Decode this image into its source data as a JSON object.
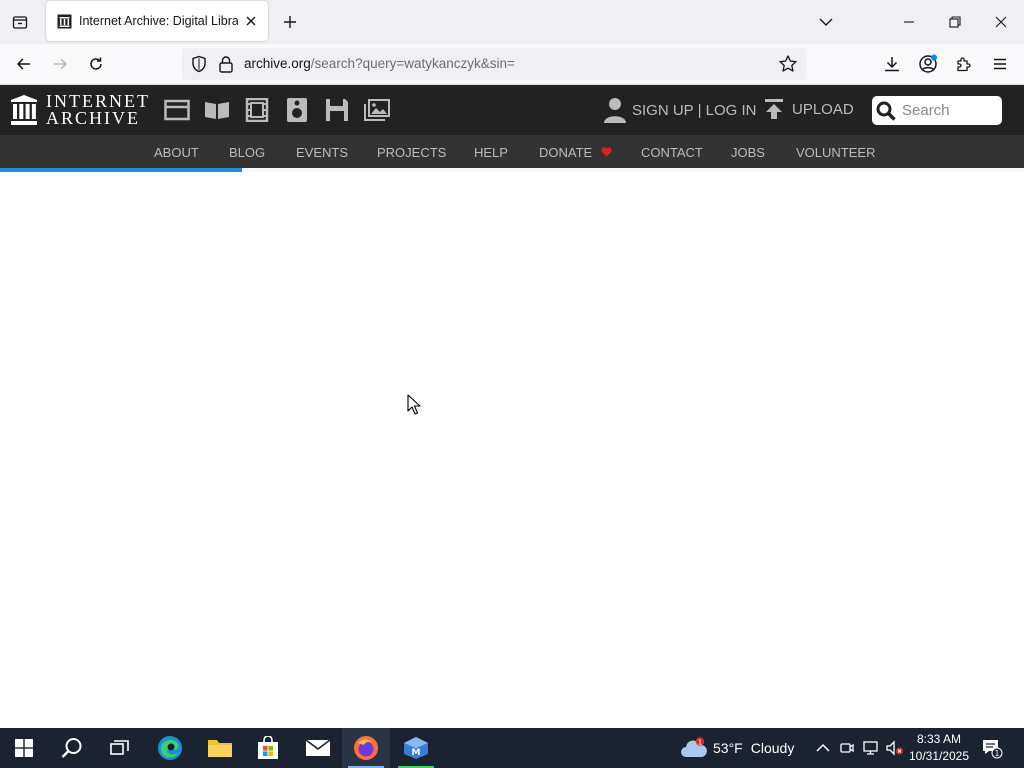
{
  "browser": {
    "tab_title": "Internet Archive: Digital Library",
    "url_host": "archive.org",
    "url_path": "/search?query=watykanczyk&sin="
  },
  "ia_header": {
    "logo_line1": "INTERNET",
    "logo_line2": "ARCHIVE",
    "media_icons": [
      "web-icon",
      "texts-icon",
      "video-icon",
      "audio-icon",
      "software-icon",
      "images-icon"
    ],
    "signup_login": "SIGN UP | LOG IN",
    "upload": "UPLOAD",
    "search_placeholder": "Search"
  },
  "ia_nav": {
    "items": [
      "ABOUT",
      "BLOG",
      "EVENTS",
      "PROJECTS",
      "HELP",
      "DONATE",
      "CONTACT",
      "JOBS",
      "VOLUNTEER"
    ]
  },
  "page_load_progress": 0.236,
  "taskbar": {
    "weather_temp": "53°F",
    "weather_text": "Cloudy",
    "weather_badge": "1",
    "clock_time": "8:33 AM",
    "clock_date": "10/31/2025",
    "notification_count": "1"
  },
  "colors": {
    "ia_header_bg": "#222222",
    "ia_nav_bg": "#333333",
    "progress": "#1e8ddb",
    "donate_heart": "#e02020",
    "taskbar_bg": "#1b2230"
  }
}
